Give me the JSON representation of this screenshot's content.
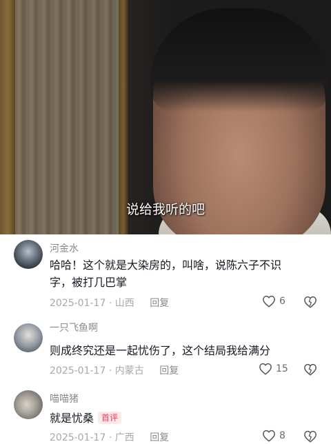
{
  "video": {
    "subtitle": "说给我听的吧"
  },
  "comments": [
    {
      "username": "河金水",
      "text_line1": "哈哈！这个就是大染房的，叫啥，说陈六子不识",
      "text_line2": "字，被打几巴掌",
      "date": "2025-01-17",
      "location": "山西",
      "reply_label": "回复",
      "likes": "6"
    },
    {
      "username": "一只飞鱼啊",
      "text_line1": "则成终究还是一起忧伤了，这个结局我给满分",
      "date": "2025-01-17",
      "location": "内蒙古",
      "reply_label": "回复",
      "likes": "15"
    },
    {
      "username": "喵喵猪",
      "text_line1": "就是忧桑",
      "badge": "首评",
      "date": "2025-01-17",
      "location": "广西",
      "reply_label": "回复",
      "likes": "8"
    }
  ],
  "icons": {
    "like": "heart-outline-icon",
    "dislike": "broken-heart-icon"
  },
  "colors": {
    "text": "#161823",
    "muted": "#a8a8a8",
    "badge": "#f23c5a"
  }
}
